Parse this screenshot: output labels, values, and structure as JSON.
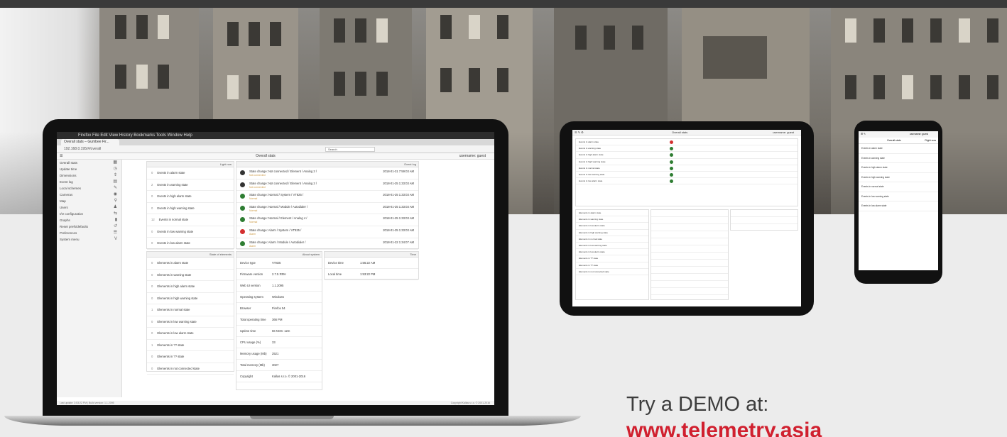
{
  "laptop": {
    "menubar": "Firefox   File   Edit   View   History   Bookmarks   Tools   Window   Help",
    "tab": "Overall stats – Gumbee Fir...",
    "url": "192.168.0.195/#/overall",
    "search_placeholder": "Search",
    "app_title": "Overall stats",
    "user": "username: guest",
    "sidebar": [
      {
        "label": "Overall stats",
        "icon": "▦"
      },
      {
        "label": "Update time",
        "icon": "◷"
      },
      {
        "label": "Dimensions",
        "icon": "⇕"
      },
      {
        "label": "Event log",
        "icon": "▤"
      },
      {
        "label": "Local schemes",
        "icon": "✎"
      },
      {
        "label": "Cameras",
        "icon": "◉"
      },
      {
        "label": "Map",
        "icon": "⚲"
      },
      {
        "label": "Users",
        "icon": "♟"
      },
      {
        "label": "I/O configuration",
        "icon": "⇆"
      },
      {
        "label": "Graphs",
        "icon": "▮"
      },
      {
        "label": "Reset prefs/defaults",
        "icon": "↺"
      },
      {
        "label": "Preferences",
        "icon": "☰"
      },
      {
        "label": "System menu",
        "icon": "V"
      }
    ],
    "events_header": "Event log",
    "event_dates": [
      "2018-01-31 7:59:03 AM",
      "2018-01-25 1:33:03 AM",
      "2018-01-25 1:33:03 AM",
      "2018-01-25 1:33:03 AM",
      "2018-01-25 1:33:03 AM",
      "2018-01-25 1:33:03 AM",
      "2018-01-22 1:34:07 AM",
      "2018-01-22 1:34:07 AM"
    ],
    "events": [
      {
        "text": "State change: Not connected / Element / Analog 2 /",
        "sub": "Not connected",
        "color": "#333333"
      },
      {
        "text": "State change: Not connected / Element / Analog 2 /",
        "sub": "Not connected",
        "color": "#333333"
      },
      {
        "text": "State change: Normal / System / VT825 /",
        "sub": "Normal",
        "color": "#2e7d32"
      },
      {
        "text": "State change: Normal / Module / Autodialer /",
        "sub": "Normal",
        "color": "#2e7d32"
      },
      {
        "text": "State change: Normal / Element / Analog 4 /",
        "sub": "Normal",
        "color": "#2e7d32"
      },
      {
        "text": "State change: Alarm / System / VT825 /",
        "sub": "Alarm",
        "color": "#d32f2f"
      },
      {
        "text": "State change: Alarm / Module / Autodialer /",
        "sub": "Alarm",
        "color": "#2e7d32"
      }
    ],
    "light_header": "Light row",
    "counters": [
      {
        "num": "0",
        "text": "Events in alarm state"
      },
      {
        "num": "2",
        "text": "Events in warning state"
      },
      {
        "num": "0",
        "text": "Events in high alarm state"
      },
      {
        "num": "0",
        "text": "Events in high warning state"
      },
      {
        "num": "12",
        "text": "Events in normal state"
      },
      {
        "num": "0",
        "text": "Events in low warning state"
      },
      {
        "num": "0",
        "text": "Events in low alarm state"
      }
    ],
    "dims_header": "State of elements",
    "dims": [
      {
        "num": "0",
        "text": "Elements in alarm state"
      },
      {
        "num": "0",
        "text": "Elements in warning state"
      },
      {
        "num": "0",
        "text": "Elements in high alarm state"
      },
      {
        "num": "0",
        "text": "Elements in high warning state"
      },
      {
        "num": "1",
        "text": "Elements in normal state"
      },
      {
        "num": "0",
        "text": "Elements in low warning state"
      },
      {
        "num": "0",
        "text": "Elements in low alarm state"
      },
      {
        "num": "1",
        "text": "Elements in ?? state"
      },
      {
        "num": "0",
        "text": "Elements in ?? state"
      },
      {
        "num": "0",
        "text": "Elements in not connected state"
      }
    ],
    "device_header": "About system",
    "device": [
      {
        "k": "Device type",
        "v": "VT825"
      },
      {
        "k": "Firmware version",
        "v": "2.7.5 ЯЯН"
      },
      {
        "k": "Web UI version",
        "v": "1.1.2095"
      },
      {
        "k": "Operating system",
        "v": "Windows"
      },
      {
        "k": "Browser",
        "v": "Firefox 54"
      },
      {
        "k": "Total operating time",
        "v": "366 PM"
      },
      {
        "k": "Uptime time",
        "v": "66 NOS: 12m"
      },
      {
        "k": "CPU usage (%)",
        "v": "33"
      },
      {
        "k": "Memory usage (Mb)",
        "v": "2521"
      },
      {
        "k": "Total memory (Mb)",
        "v": "3027"
      },
      {
        "k": "Copyright",
        "v": "Kallas s.r.o. © 2001-2016"
      }
    ],
    "time_header": "Time",
    "time": [
      {
        "k": "Device time",
        "v": "1:56:22 AM"
      },
      {
        "k": "Local time",
        "v": "1:53:22 PM"
      }
    ],
    "status_left": "Last update: 3:53:22 PM | Build version: 1.1.2095",
    "status_right": "Copyright Kallas s.r.o. © 2001-2016"
  },
  "tablet": {
    "title": "Overall stats",
    "user": "username: guest",
    "rows": [
      "Events in alarm state",
      "Events in warning state",
      "Events in high alarm state",
      "Events in high warning state",
      "Events in normal state",
      "Events in low warning state",
      "Events in low alarm state"
    ],
    "dims": [
      "Elements in alarm state",
      "Elements in warning state",
      "Elements in low alarm state",
      "Elements in high warning state",
      "Elements in normal state",
      "Elements in low warning state",
      "Elements in low alarm state",
      "Elements in ?? state",
      "Elements in ?? state",
      "Elements in not connected state"
    ]
  },
  "phone": {
    "title": "Overall stats",
    "user": "username: guest",
    "tab": "Right now",
    "rows": [
      "Events in alarm state",
      "Events in warning state",
      "Events in high alarm state",
      "Events in high warning state",
      "Events in normal state",
      "Events in low warning state",
      "Events in low alarm state"
    ]
  },
  "cta": {
    "line1": "Try a DEMO at:",
    "line2": "www.telemetry.asia"
  },
  "colors": {
    "accent": "#d1202f",
    "bezel": "#111111",
    "text": "#3d3d3d"
  }
}
